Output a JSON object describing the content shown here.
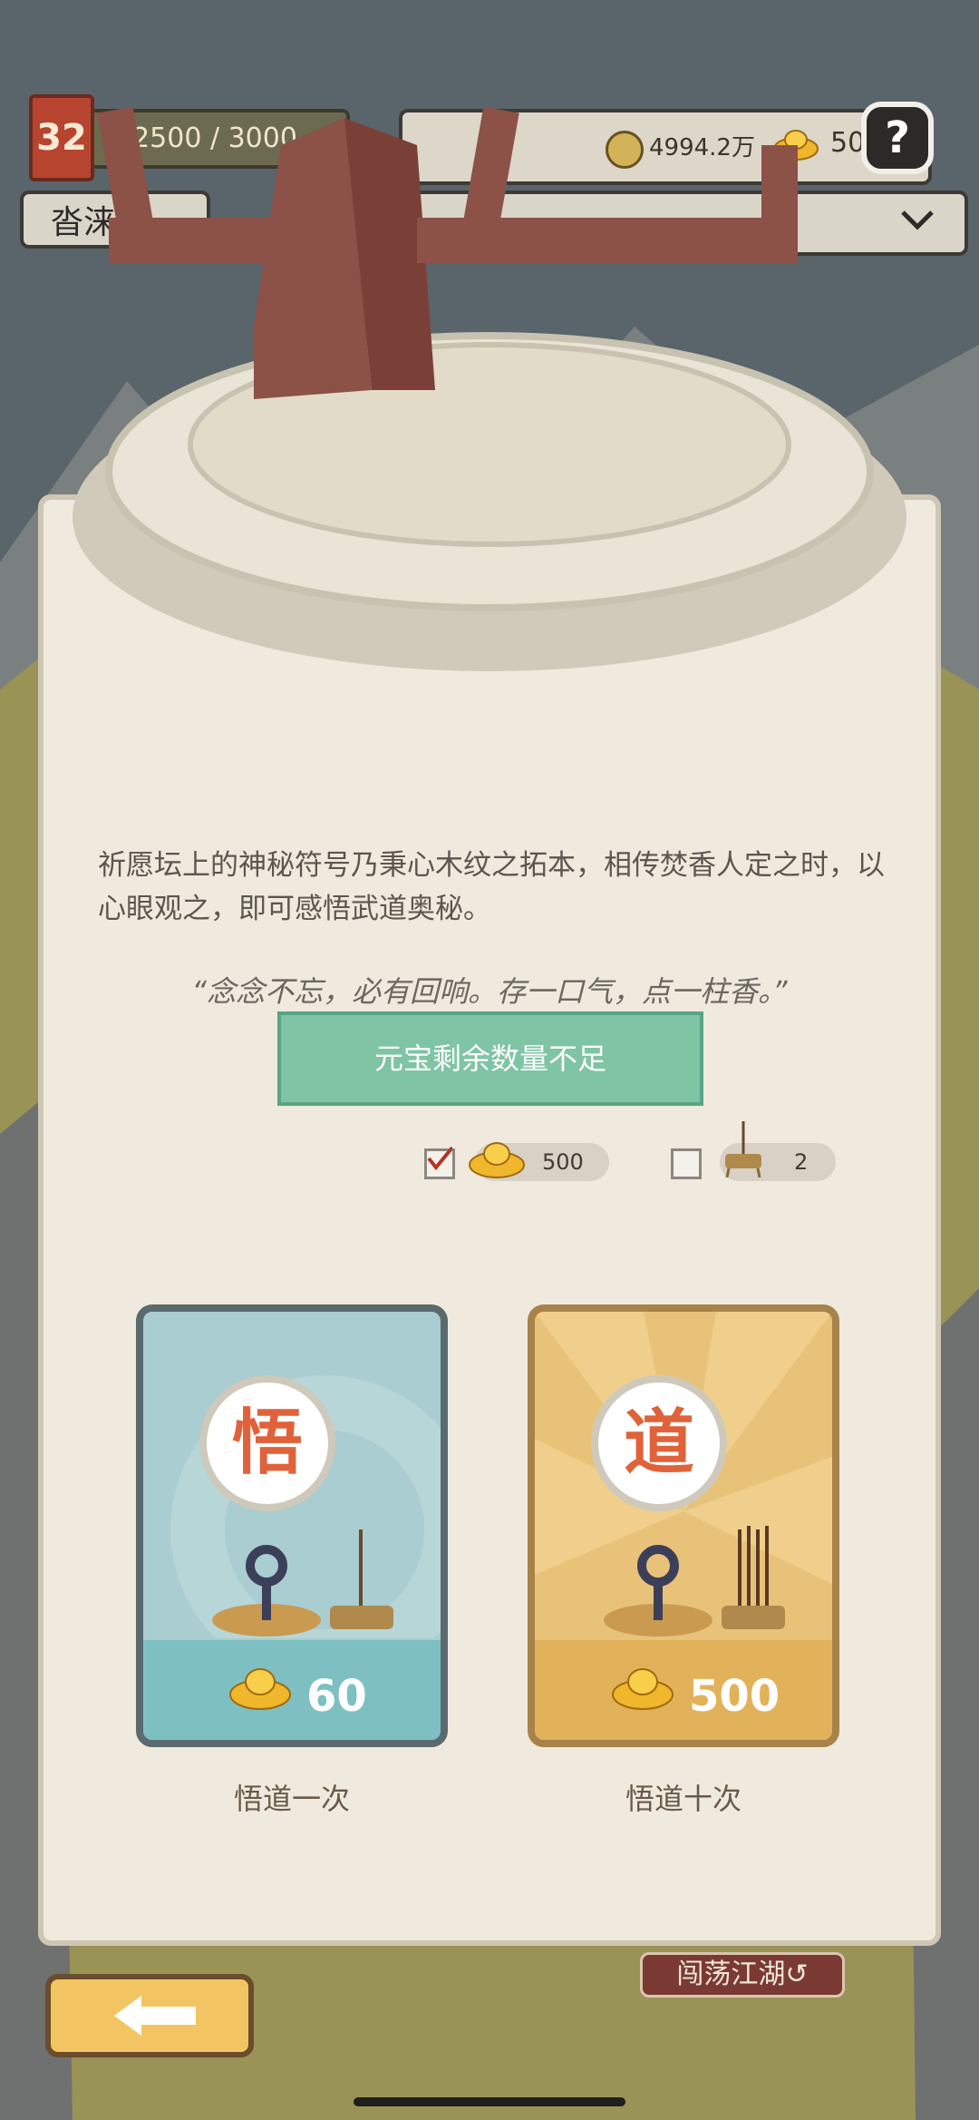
{
  "hud": {
    "level": "32",
    "xp": "2500 / 3000",
    "player_name": "沓涞",
    "copper": "4994.2万",
    "ingots": "500",
    "help": "?"
  },
  "panel": {
    "description": "祈愿坛上的神秘符号乃秉心木纹之拓本，相传焚香人定之时，以心眼观之，即可感悟武道奥秘。",
    "quote": "“念念不忘，必有回响。存一口气，点一柱香。”",
    "status_button": "元宝剩余数量不足",
    "options": [
      {
        "checked": true,
        "value": "500"
      },
      {
        "checked": false,
        "value": "2"
      }
    ]
  },
  "cards": [
    {
      "glyph": "悟",
      "price": "60",
      "label": "悟道一次"
    },
    {
      "glyph": "道",
      "price": "500",
      "label": "悟道十次"
    }
  ],
  "footer": {
    "road_tag": "闯荡江湖↺"
  },
  "colors": {
    "panel": "#efeadd",
    "accent_green": "#7fc4a4",
    "card_blue": "#a9cdd0",
    "card_gold": "#e9c27a"
  }
}
